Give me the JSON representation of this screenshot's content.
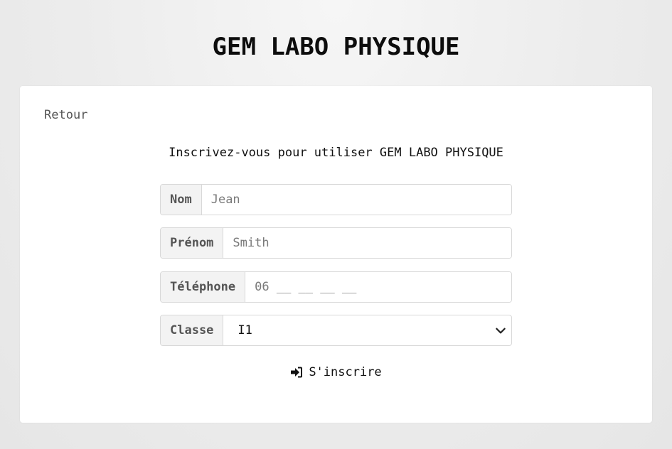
{
  "header": {
    "title": "GEM LABO PHYSIQUE"
  },
  "card": {
    "back_label": "Retour",
    "subtitle": "Inscrivez-vous pour utiliser GEM LABO PHYSIQUE"
  },
  "form": {
    "nom": {
      "label": "Nom",
      "placeholder": "Jean",
      "value": ""
    },
    "prenom": {
      "label": "Prénom",
      "placeholder": "Smith",
      "value": ""
    },
    "telephone": {
      "label": "Téléphone",
      "placeholder": "06 __ __ __ __",
      "value": ""
    },
    "classe": {
      "label": "Classe",
      "selected": "I1"
    },
    "submit_label": "S'inscrire",
    "submit_icon": "sign-in-icon"
  }
}
